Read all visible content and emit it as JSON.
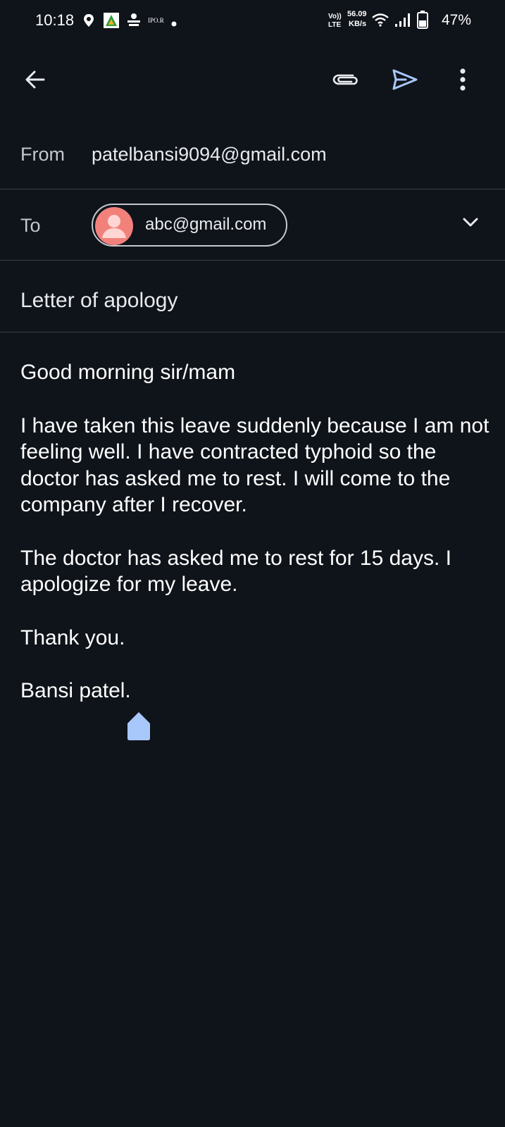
{
  "status_bar": {
    "time": "10:18",
    "notif_text": "IPO.R",
    "network_label_top": "Vo))",
    "network_label_bottom": "LTE",
    "speed_value": "56.09",
    "speed_unit": "KB/s",
    "battery": "47%"
  },
  "toolbar": {
    "back_icon": "arrow-left-icon",
    "attach_icon": "paperclip-icon",
    "send_icon": "send-icon",
    "more_icon": "more-vert-icon"
  },
  "compose": {
    "from_label": "From",
    "from_value": "patelbansi9094@gmail.com",
    "to_label": "To",
    "to_chip": "abc@gmail.com",
    "subject": "Letter of apology",
    "body": [
      "Good morning sir/mam",
      "I have taken this leave suddenly because I am not feeling well. I have contracted typhoid so the doctor has asked me to rest. I will come to the company after I recover.",
      "The doctor has asked me to rest for 15 days. I apologize for my leave.",
      "Thank you.",
      "Bansi patel."
    ]
  },
  "colors": {
    "background": "#0f131a",
    "accent": "#a8c7fa",
    "avatar": "#f2817b",
    "divider": "#3c4048"
  }
}
